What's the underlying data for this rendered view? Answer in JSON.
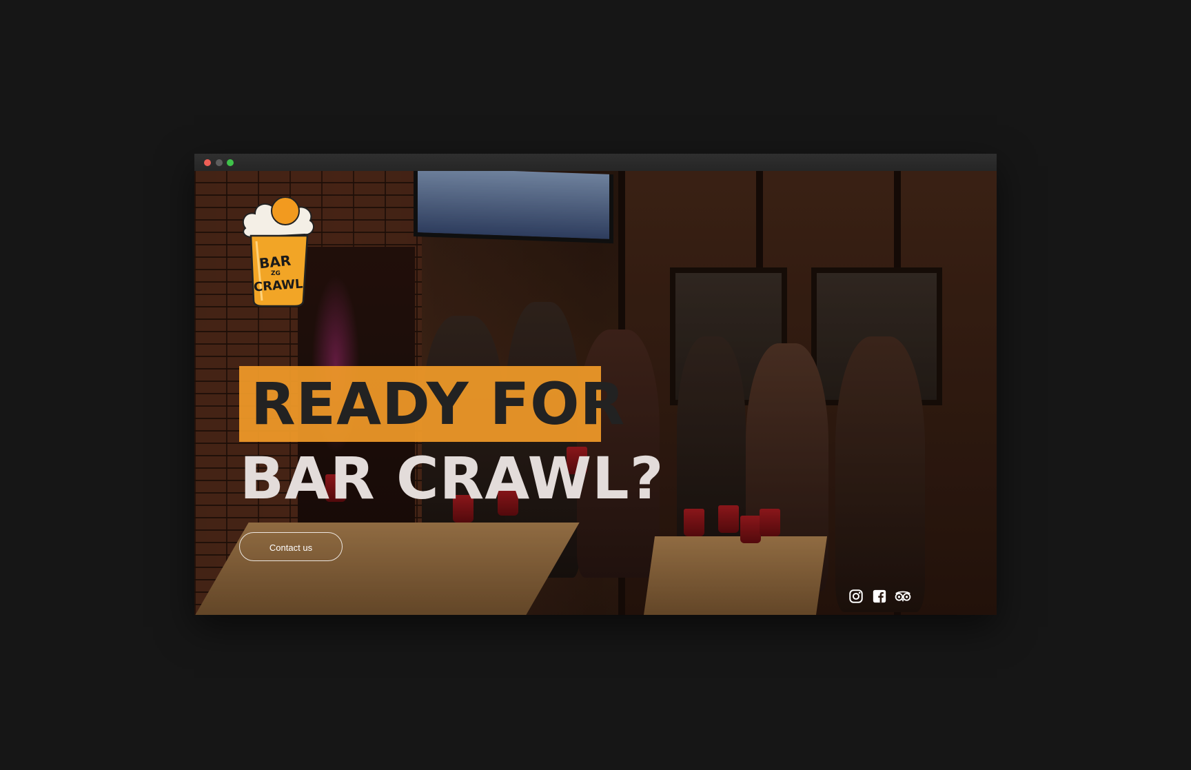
{
  "window": {
    "controls": [
      "close",
      "minimize",
      "maximize"
    ]
  },
  "hero": {
    "headline_line1": "READY FOR",
    "headline_line2": "BAR CRAWL?",
    "cta_label": "Contact us",
    "accent_color": "#f09a29"
  },
  "logo": {
    "text_top": "BAR",
    "text_middle": "ZG",
    "text_bottom": "CRAWL"
  },
  "social": {
    "icons": [
      "instagram-icon",
      "facebook-icon",
      "tripadvisor-icon"
    ]
  }
}
